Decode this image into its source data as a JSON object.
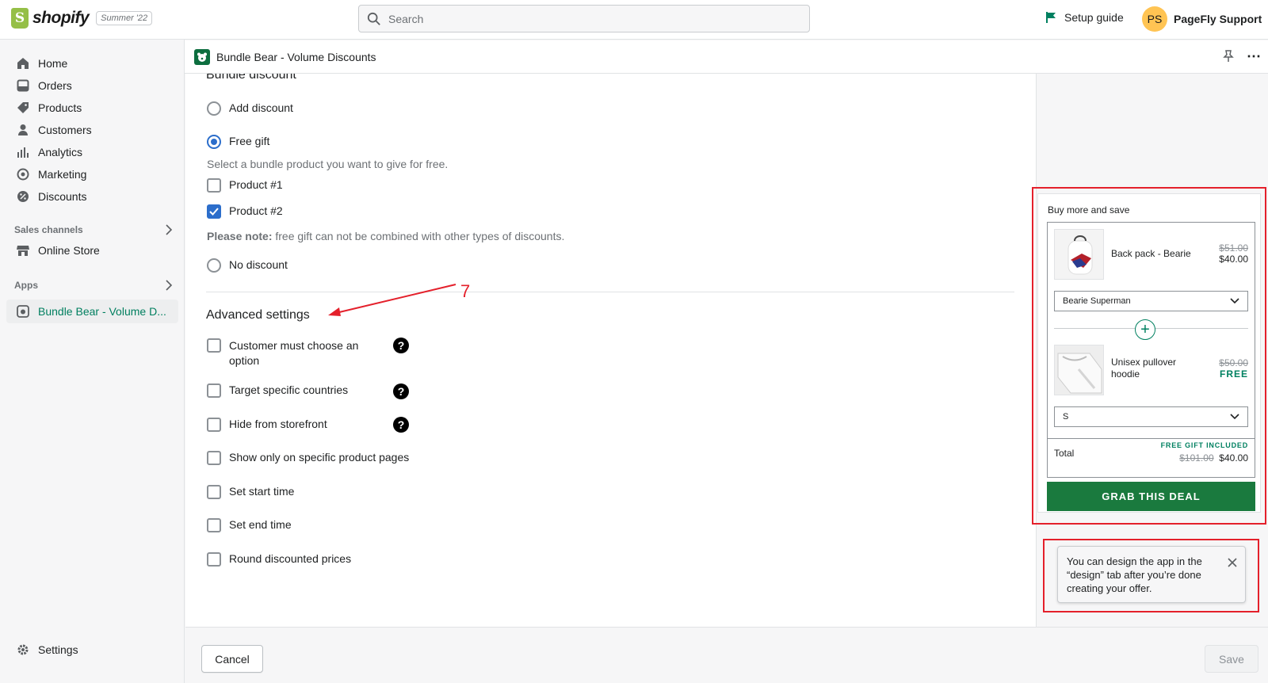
{
  "topbar": {
    "brand": "shopify",
    "edition": "Summer '22",
    "search_placeholder": "Search",
    "setup_guide": "Setup guide",
    "user_initials": "PS",
    "user_name": "PageFly Support"
  },
  "sidebar": {
    "items": [
      {
        "label": "Home",
        "icon": "home-icon"
      },
      {
        "label": "Orders",
        "icon": "orders-icon"
      },
      {
        "label": "Products",
        "icon": "tag-icon"
      },
      {
        "label": "Customers",
        "icon": "person-icon"
      },
      {
        "label": "Analytics",
        "icon": "bar-chart-icon"
      },
      {
        "label": "Marketing",
        "icon": "target-icon"
      },
      {
        "label": "Discounts",
        "icon": "discount-icon"
      }
    ],
    "sales_channels_label": "Sales channels",
    "online_store": "Online Store",
    "apps_label": "Apps",
    "active_app": "Bundle Bear - Volume D...",
    "settings": "Settings"
  },
  "app_header": {
    "title": "Bundle Bear - Volume Discounts"
  },
  "form": {
    "bundle_discount_title": "Bundle discount",
    "add_discount": "Add discount",
    "free_gift": "Free gift",
    "free_gift_hint": "Select a bundle product you want to give for free.",
    "product1": "Product #1",
    "product2": "Product #2",
    "note_label": "Please note:",
    "note_text": " free gift can not be combined with other types of discounts.",
    "no_discount": "No discount",
    "advanced_title": "Advanced settings",
    "customer_choose_line1": "Customer must choose an",
    "customer_choose_line2": "option",
    "target_countries": "Target specific countries",
    "hide_storefront": "Hide from storefront",
    "show_specific": "Show only on specific product pages",
    "start_time": "Set start time",
    "end_time": "Set end time",
    "round_prices": "Round discounted prices",
    "selected_discount": "Free gift",
    "product1_checked": false,
    "product2_checked": true
  },
  "annotation": "7",
  "preview": {
    "title": "Buy more and save",
    "item1_name": "Back pack - Bearie",
    "item1_old": "$51.00",
    "item1_new": "$40.00",
    "item1_variant": "Bearie Superman",
    "item2_name_l1": "Unisex pullover",
    "item2_name_l2": "hoodie",
    "item2_old": "$50.00",
    "item2_new": "FREE",
    "item2_variant": "S",
    "total_label": "Total",
    "free_gift_included": "FREE GIFT INCLUDED",
    "total_old": "$101.00",
    "total_new": "$40.00",
    "cta": "GRAB THIS DEAL"
  },
  "toast": {
    "text": "You can design the app in the “design” tab after you’re done creating your offer."
  },
  "footer": {
    "cancel": "Cancel",
    "save": "Save"
  },
  "colors": {
    "accent_green": "#008060",
    "cta_green": "#1a7a3e",
    "checkbox_blue": "#2c6ecb",
    "annotation_red": "#e4202b"
  }
}
